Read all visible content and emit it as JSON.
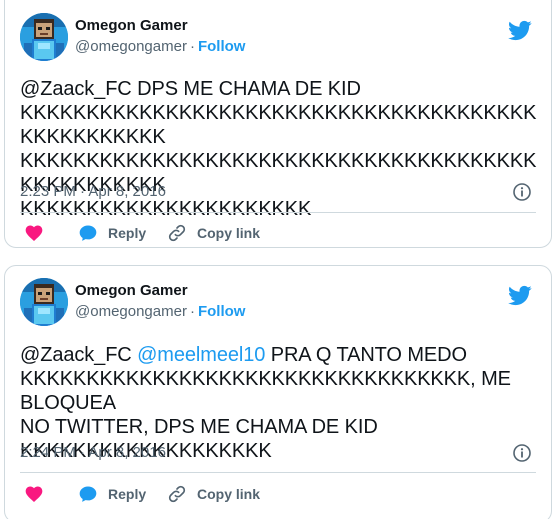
{
  "colors": {
    "accent": "#1d9bf0",
    "like": "#f91880",
    "muted": "#536471",
    "text": "#0f1419",
    "border": "#cfd9de"
  },
  "tweets": [
    {
      "author": {
        "name": "Omegon Gamer",
        "handle": "@omegongamer",
        "dot": "·",
        "follow_label": "Follow"
      },
      "text_parts": [
        {
          "kind": "plain",
          "text": "@Zaack_FC DPS ME CHAMA DE KID KKKKKKKKKKKKKKKKKKKKKKKKKKKKKKKKKKKKKKKKKKKKKKKKKKKKKKKKKKKKKKKKKKKKKKKKKKKKKKKKKKKKKKKKKKKKKKKKKKKKKKKKKKKKKKKKKKKKKK"
        }
      ],
      "lines": [
        "@Zaack_FC DPS ME CHAMA DE KID",
        "KKKKKKKKKKKKKKKKKKKKKKKKKKKKKKKKKKKKKKKKKKKKKKKKKK",
        "KKKKKKKKKKKKKKKKKKKKKKKKKKKKKKKKKKKKKKKKKKKKKKKKKK",
        "KKKKKKKKKKKKKKKKKKKKKK"
      ],
      "timestamp": "2:23 PM · Apr 8, 2016",
      "actions": {
        "reply": "Reply",
        "copy_link": "Copy link"
      },
      "icons": {
        "brand": "twitter-bird-icon",
        "info": "info-icon",
        "like": "heart-icon",
        "reply": "comment-icon",
        "copy": "link-icon"
      }
    },
    {
      "author": {
        "name": "Omegon Gamer",
        "handle": "@omegongamer",
        "dot": "·",
        "follow_label": "Follow"
      },
      "line1_prefix": "@Zaack_FC ",
      "line1_mention": "@meelmeel10",
      "line1_suffix": " PRA Q TANTO MEDO",
      "lines_rest": [
        "KKKKKKKKKKKKKKKKKKKKKKKKKKKKKKKKKK, ME BLOQUEA",
        "NO TWITTER, DPS ME CHAMA DE KID",
        "KKKKKKKKKKKKKKKKKKK"
      ],
      "timestamp": "2:24 PM · Apr 8, 2016",
      "actions": {
        "reply": "Reply",
        "copy_link": "Copy link"
      },
      "icons": {
        "brand": "twitter-bird-icon",
        "info": "info-icon",
        "like": "heart-icon",
        "reply": "comment-icon",
        "copy": "link-icon"
      }
    }
  ]
}
